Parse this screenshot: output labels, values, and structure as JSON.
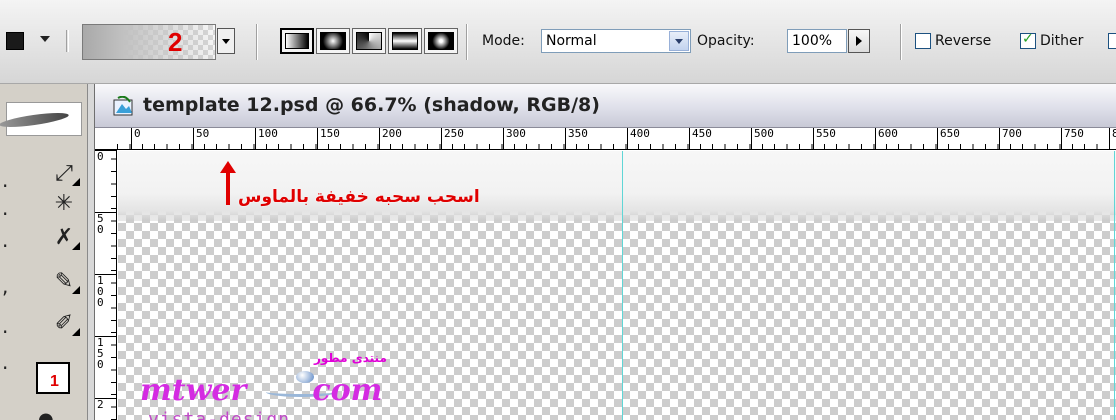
{
  "options_bar": {
    "gradient_picker": {
      "badge": "2"
    },
    "gradient_types": [
      "linear-gradient-icon",
      "radial-gradient-icon",
      "angle-gradient-icon",
      "reflected-gradient-icon",
      "diamond-gradient-icon"
    ],
    "mode_label": "Mode:",
    "mode_value": "Normal",
    "opacity_label": "Opacity:",
    "opacity_value": "100%",
    "reverse_label": "Reverse",
    "reverse_checked": false,
    "dither_label": "Dither",
    "dither_checked": true
  },
  "toolbox": {
    "tools": [
      "move-icon",
      "magic-wand-icon",
      "healing-brush-icon",
      "brush-icon",
      "history-brush-icon",
      "gradient-tool-icon"
    ],
    "active_badge": "1"
  },
  "document": {
    "title": "template 12.psd @ 66.7% (shadow, RGB/8)",
    "ruler_h_labels": [
      "0",
      "50",
      "100",
      "150",
      "200",
      "250",
      "300",
      "350",
      "400",
      "450",
      "500",
      "550",
      "600",
      "650",
      "700",
      "750",
      "8"
    ],
    "ruler_v_labels": [
      [
        "0"
      ],
      [
        "5",
        "0"
      ],
      [
        "1",
        "0",
        "0"
      ],
      [
        "1",
        "5",
        "0"
      ],
      [
        "2"
      ]
    ],
    "annotation": "اسحب سحبه خفيفة بالماوس",
    "watermark_main": "mtwer",
    "watermark_main2": "com",
    "watermark_arabic": "منتدى مطور",
    "watermark_sub": "vista-design"
  },
  "colors": {
    "accent_red": "#e00000",
    "guide": "#5fd6d6",
    "watermark": "#d42be2"
  }
}
